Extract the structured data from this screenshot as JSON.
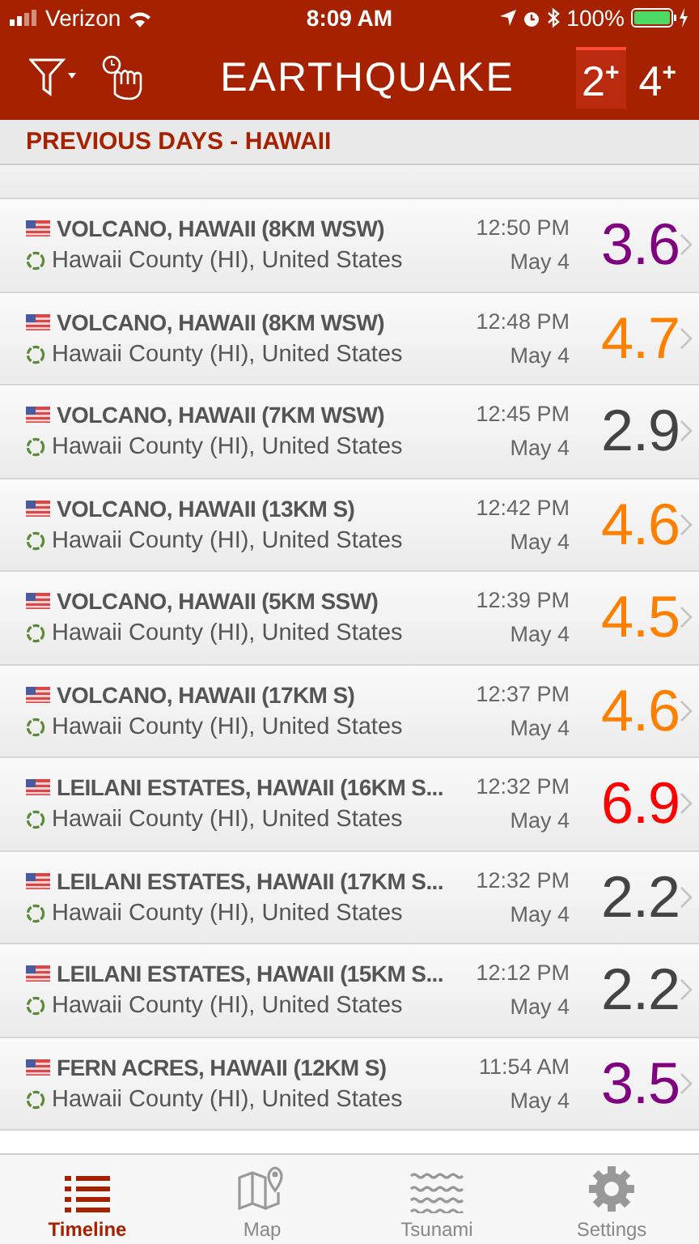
{
  "status_bar": {
    "carrier": "Verizon",
    "time": "8:09 AM",
    "battery": "100%"
  },
  "nav": {
    "title": "EARTHQUAKE",
    "filters": [
      {
        "label": "2$^{+}$",
        "selected": true
      },
      {
        "label": "4$^{+}$",
        "selected": false
      }
    ]
  },
  "section_header": "PREVIOUS DAYS - HAWAII",
  "quakes": [
    {
      "place": "VOLCANO, HAWAII (8KM WSW)",
      "region": "Hawaii County (HI), United States",
      "time": "12:50 PM",
      "date": "May 4",
      "magnitude": "3.6",
      "color": "#800080"
    },
    {
      "place": "VOLCANO, HAWAII (8KM WSW)",
      "region": "Hawaii County (HI), United States",
      "time": "12:48 PM",
      "date": "May 4",
      "magnitude": "4.7",
      "color": "#ff8000"
    },
    {
      "place": "VOLCANO, HAWAII (7KM WSW)",
      "region": "Hawaii County (HI), United States",
      "time": "12:45 PM",
      "date": "May 4",
      "magnitude": "2.9",
      "color": "#444444"
    },
    {
      "place": "VOLCANO, HAWAII (13KM S)",
      "region": "Hawaii County (HI), United States",
      "time": "12:42 PM",
      "date": "May 4",
      "magnitude": "4.6",
      "color": "#ff8000"
    },
    {
      "place": "VOLCANO, HAWAII (5KM SSW)",
      "region": "Hawaii County (HI), United States",
      "time": "12:39 PM",
      "date": "May 4",
      "magnitude": "4.5",
      "color": "#ff8000"
    },
    {
      "place": "VOLCANO, HAWAII (17KM S)",
      "region": "Hawaii County (HI), United States",
      "time": "12:37 PM",
      "date": "May 4",
      "magnitude": "4.6",
      "color": "#ff8000"
    },
    {
      "place": "LEILANI ESTATES, HAWAII (16KM S...",
      "region": "Hawaii County (HI), United States",
      "time": "12:32 PM",
      "date": "May 4",
      "magnitude": "6.9",
      "color": "#ff0000"
    },
    {
      "place": "LEILANI ESTATES, HAWAII (17KM S...",
      "region": "Hawaii County (HI), United States",
      "time": "12:32 PM",
      "date": "May 4",
      "magnitude": "2.2",
      "color": "#444444"
    },
    {
      "place": "LEILANI ESTATES, HAWAII (15KM S...",
      "region": "Hawaii County (HI), United States",
      "time": "12:12 PM",
      "date": "May 4",
      "magnitude": "2.2",
      "color": "#444444"
    },
    {
      "place": "FERN ACRES, HAWAII (12KM S)",
      "region": "Hawaii County (HI), United States",
      "time": "11:54 AM",
      "date": "May 4",
      "magnitude": "3.5",
      "color": "#800080"
    }
  ],
  "tabs": [
    {
      "label": "Timeline",
      "kind": "list",
      "selected": true
    },
    {
      "label": "Map",
      "kind": "map",
      "selected": false
    },
    {
      "label": "Tsunami",
      "kind": "waves",
      "selected": false
    },
    {
      "label": "Settings",
      "kind": "gear",
      "selected": false
    }
  ]
}
